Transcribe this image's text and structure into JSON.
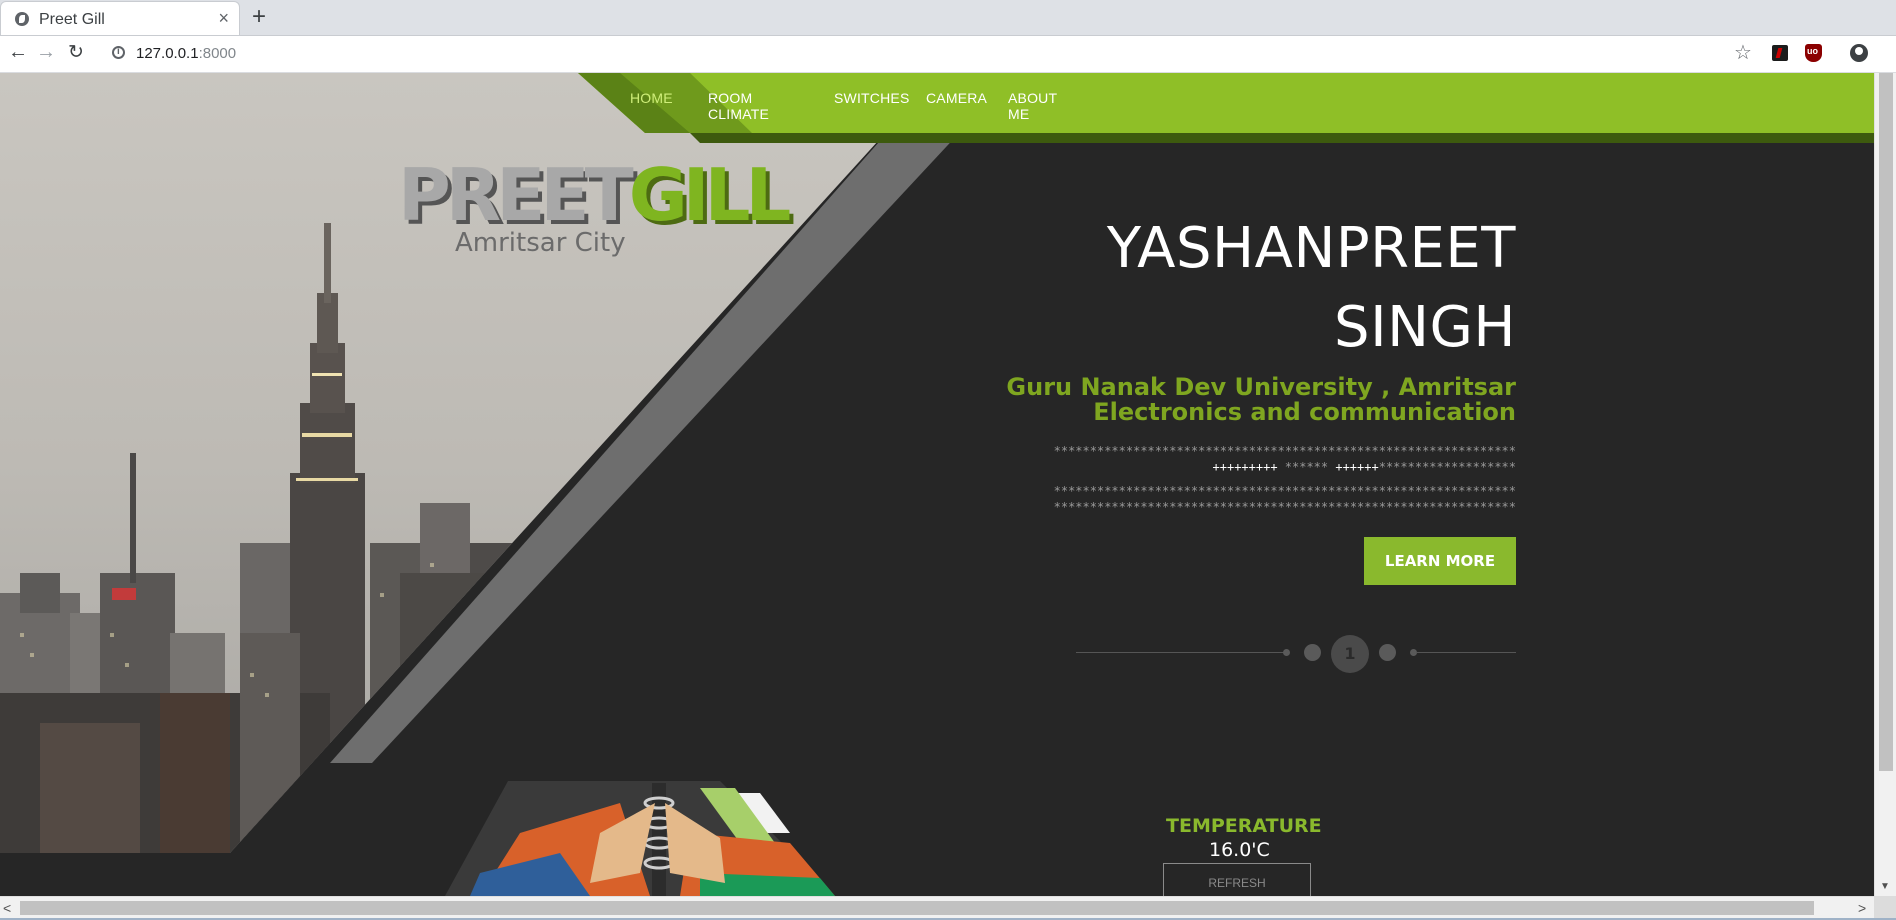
{
  "browser": {
    "tab_title": "Preet Gill",
    "new_tab_label": "+",
    "close_label": "×",
    "url_host": "127.0.0.1",
    "url_port": ":8000"
  },
  "nav": {
    "items": [
      {
        "label": "HOME",
        "active": true
      },
      {
        "label": "ROOM CLIMATE",
        "active": false
      },
      {
        "label": "SWITCHES",
        "active": false
      },
      {
        "label": "CAMERA",
        "active": false
      },
      {
        "label": "ABOUT ME",
        "active": false
      }
    ]
  },
  "logo": {
    "part1": "PREET",
    "part2": "GILL",
    "city": "Amritsar City"
  },
  "hero": {
    "name_line1": "YASHANPREET",
    "name_line2": "SINGH",
    "uni_line1": "Guru Nanak Dev University , Amritsar",
    "uni_line2": "Electronics and communication",
    "stars_line1": "****************************************************************",
    "stars_line2_a": "+++++++++",
    "stars_line2_b": " ****** ",
    "stars_line2_c": "++++++",
    "stars_line2_d": "*******************",
    "stars_line3": "****************************************************************",
    "stars_line4": "****************************************************************",
    "cta": "LEARN MORE"
  },
  "pager": {
    "current": "1"
  },
  "temperature": {
    "title": "TEMPERATURE",
    "value": "16.0'C",
    "refresh": "REFRESH"
  },
  "colors": {
    "accent_green": "#8ab92d",
    "dark_bg": "#262626",
    "nav_active": "#cfee7a"
  }
}
